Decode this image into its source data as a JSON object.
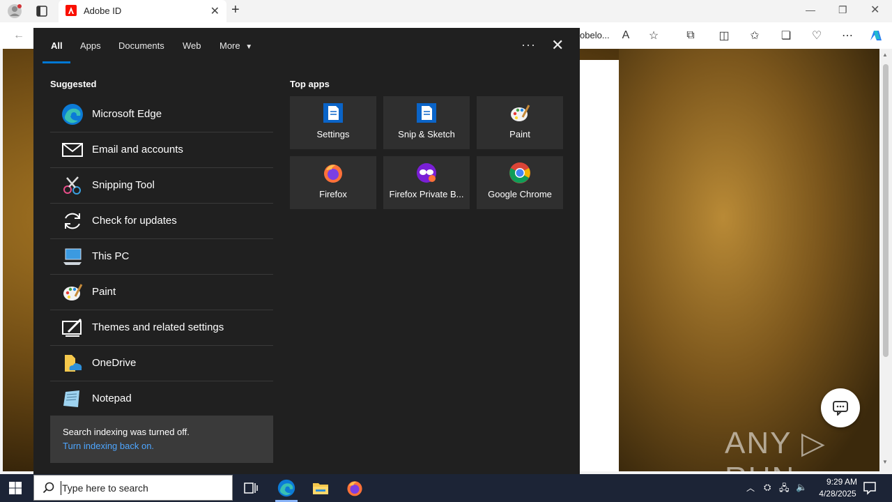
{
  "browser": {
    "tab_title": "Adobe ID",
    "address_tail": "obelo...",
    "new_tab_label": "+"
  },
  "search_panel": {
    "tabs": [
      "All",
      "Apps",
      "Documents",
      "Web",
      "More"
    ],
    "suggested_title": "Suggested",
    "top_apps_title": "Top apps",
    "suggested": [
      {
        "label": "Microsoft Edge",
        "icon": "edge-icon"
      },
      {
        "label": "Email and accounts",
        "icon": "mail-icon"
      },
      {
        "label": "Snipping Tool",
        "icon": "scissors-icon"
      },
      {
        "label": "Check for updates",
        "icon": "refresh-icon"
      },
      {
        "label": "This PC",
        "icon": "computer-icon"
      },
      {
        "label": "Paint",
        "icon": "paint-palette-icon"
      },
      {
        "label": "Themes and related settings",
        "icon": "themes-icon"
      },
      {
        "label": "OneDrive",
        "icon": "onedrive-icon"
      },
      {
        "label": "Notepad",
        "icon": "notepad-icon"
      }
    ],
    "top_apps": [
      {
        "label": "Settings",
        "icon": "settings-doc-icon"
      },
      {
        "label": "Snip & Sketch",
        "icon": "snip-sketch-icon"
      },
      {
        "label": "Paint",
        "icon": "paint-palette-icon"
      },
      {
        "label": "Firefox",
        "icon": "firefox-icon"
      },
      {
        "label": "Firefox Private B...",
        "icon": "firefox-private-icon"
      },
      {
        "label": "Google Chrome",
        "icon": "chrome-icon"
      }
    ],
    "index_message": "Search indexing was turned off.",
    "index_link": "Turn indexing back on."
  },
  "page": {
    "watermark": "ANY ▷ RUN"
  },
  "taskbar": {
    "search_placeholder": "Type here to search",
    "time": "9:29 AM",
    "date": "4/28/2025"
  },
  "colors": {
    "accent": "#0078d4",
    "panel_bg": "#202020",
    "tile_bg": "#2f2f2f",
    "link": "#4ea6ff"
  }
}
